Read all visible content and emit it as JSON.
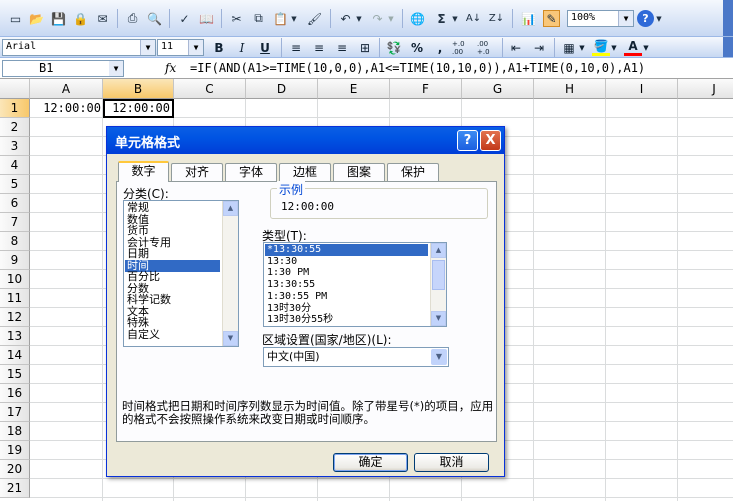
{
  "toolbar": {
    "zoom": "100%",
    "font_name": "Arial",
    "font_size": "11",
    "bold": "B",
    "italic": "I",
    "underline": "U",
    "percent": "%",
    "comma": ",",
    "incdec": "+.0 .00",
    "decdec": ".00 +.0"
  },
  "formula_bar": {
    "name_box": "B1",
    "fx": "fx",
    "formula": "=IF(AND(A1>=TIME(10,0,0),A1<=TIME(10,10,0)),A1+TIME(0,10,0),A1)"
  },
  "sheet": {
    "columns": [
      "A",
      "B",
      "C",
      "D",
      "E",
      "F",
      "G",
      "H",
      "I",
      "J"
    ],
    "rows": [
      "1",
      "2",
      "3",
      "4",
      "5",
      "6",
      "7",
      "8",
      "9",
      "10",
      "11",
      "12",
      "13",
      "14",
      "15",
      "16",
      "17",
      "18",
      "19",
      "20",
      "21"
    ],
    "cells": {
      "A1": "12:00:00",
      "B1": "12:00:00"
    }
  },
  "dialog": {
    "title": "单元格格式",
    "help": "?",
    "close": "X",
    "tabs": [
      "数字",
      "对齐",
      "字体",
      "边框",
      "图案",
      "保护"
    ],
    "active_tab": "数字",
    "category_label": "分类(C):",
    "categories": [
      "常规",
      "数值",
      "货币",
      "会计专用",
      "日期",
      "时间",
      "百分比",
      "分数",
      "科学记数",
      "文本",
      "特殊",
      "自定义"
    ],
    "selected_category": "时间",
    "sample_label": "示例",
    "sample_value": "12:00:00",
    "type_label": "类型(T):",
    "types": [
      "*13:30:55",
      "13:30",
      "1:30 PM",
      "13:30:55",
      "1:30:55 PM",
      "13时30分",
      "13时30分55秒"
    ],
    "selected_type": "*13:30:55",
    "locale_label": "区域设置(国家/地区)(L):",
    "locale_value": "中文(中国)",
    "description": "时间格式把日期和时间序列数显示为时间值。除了带星号(*)的项目，应用的格式不会按照操作系统来改变日期或时间顺序。",
    "ok": "确定",
    "cancel": "取消"
  }
}
